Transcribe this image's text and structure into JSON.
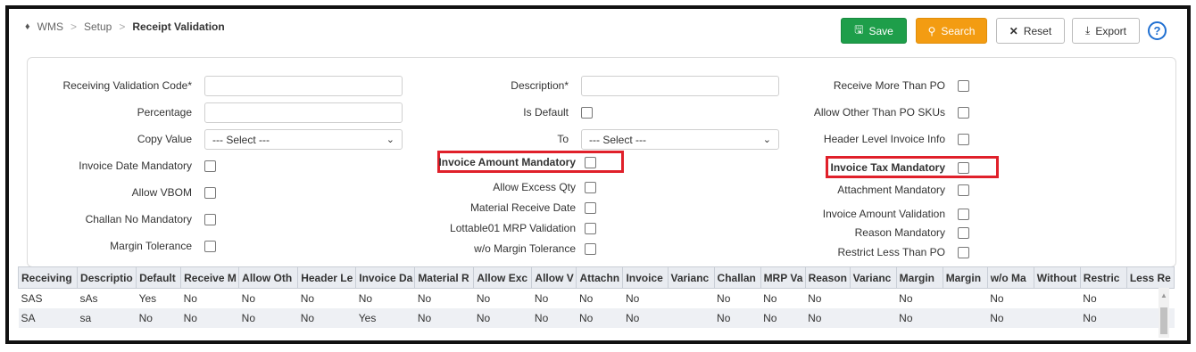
{
  "breadcrumb": {
    "home": "WMS",
    "setup": "Setup",
    "current": "Receipt Validation"
  },
  "toolbar": {
    "save": "Save",
    "search": "Search",
    "reset": "Reset",
    "export": "Export",
    "help": "?"
  },
  "form": {
    "col1": {
      "receiving_validation_code": "Receiving Validation Code*",
      "percentage": "Percentage",
      "copy_value": "Copy Value",
      "copy_value_selected": "--- Select ---",
      "invoice_date_mandatory": "Invoice Date Mandatory",
      "allow_vbom": "Allow VBOM",
      "challan_no_mandatory": "Challan No Mandatory",
      "margin_tolerance": "Margin Tolerance"
    },
    "col2": {
      "description": "Description*",
      "is_default": "Is Default",
      "to": "To",
      "to_selected": "--- Select ---",
      "invoice_amount_mandatory": "Invoice Amount Mandatory",
      "allow_excess_qty": "Allow Excess Qty",
      "material_receive_date": "Material Receive Date",
      "lottable01_mrp_validation": "Lottable01 MRP Validation",
      "wo_margin_tolerance": "w/o Margin Tolerance"
    },
    "col3": {
      "receive_more_than_po": "Receive More Than PO",
      "allow_other_than_po_skus": "Allow Other Than PO SKUs",
      "header_level_invoice_info": "Header Level Invoice Info",
      "invoice_tax_mandatory": "Invoice Tax Mandatory",
      "attachment_mandatory": "Attachment Mandatory",
      "invoice_amount_validation": "Invoice Amount Validation",
      "reason_mandatory": "Reason Mandatory",
      "restrict_less_than_po": "Restrict Less Than PO"
    }
  },
  "table": {
    "columns": [
      "Receiving",
      "Descriptio",
      "Default",
      "Receive M",
      "Allow Oth",
      "Header Le",
      "Invoice Da",
      "Material R",
      "Allow Exc",
      "Allow V",
      "Attachn",
      "Invoice",
      "Varianc",
      "Challan",
      "MRP Va",
      "Reason",
      "Varianc",
      "Margin",
      "Margin",
      "w/o Ma",
      "Without",
      "Restric",
      "Less Re"
    ],
    "rows": [
      [
        "SAS",
        "sAs",
        "Yes",
        "No",
        "No",
        "No",
        "No",
        "No",
        "No",
        "No",
        "No",
        "No",
        "",
        "No",
        "No",
        "No",
        "",
        "No",
        "",
        "No",
        "",
        "No",
        ""
      ],
      [
        "SA",
        "sa",
        "No",
        "No",
        "No",
        "No",
        "Yes",
        "No",
        "No",
        "No",
        "No",
        "No",
        "",
        "No",
        "No",
        "No",
        "",
        "No",
        "",
        "No",
        "",
        "No",
        ""
      ]
    ]
  }
}
